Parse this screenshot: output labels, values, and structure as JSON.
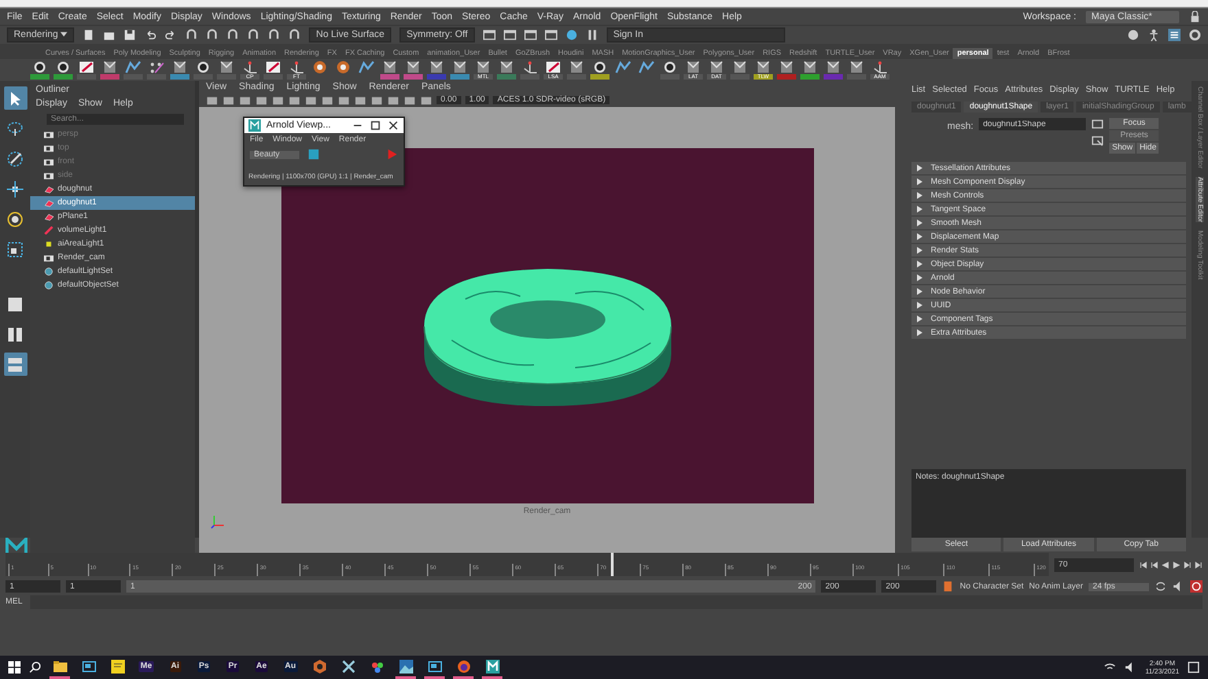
{
  "menu_bar": {
    "items": [
      "File",
      "Edit",
      "Create",
      "Select",
      "Modify",
      "Display",
      "Windows",
      "Lighting/Shading",
      "Texturing",
      "Render",
      "Toon",
      "Stereo",
      "Cache",
      "V-Ray",
      "Arnold",
      "OpenFlight",
      "Substance",
      "Help"
    ],
    "workspace_label": "Workspace :",
    "workspace": "Maya Classic*"
  },
  "status_line": {
    "menu_set": "Rendering",
    "live_surface": "No Live Surface",
    "symmetry": "Symmetry: Off",
    "sign_in": "Sign In"
  },
  "shelf": {
    "tabs": [
      {
        "label": "Curves / Surfaces",
        "selected": false
      },
      {
        "label": "Poly Modeling",
        "selected": false
      },
      {
        "label": "Sculpting",
        "selected": false
      },
      {
        "label": "Rigging",
        "selected": false
      },
      {
        "label": "Animation",
        "selected": false
      },
      {
        "label": "Rendering",
        "selected": false
      },
      {
        "label": "FX",
        "selected": false
      },
      {
        "label": "FX Caching",
        "selected": false
      },
      {
        "label": "Custom",
        "selected": false
      },
      {
        "label": "animation_User",
        "selected": false
      },
      {
        "label": "Bullet",
        "selected": false
      },
      {
        "label": "GoZBrush",
        "selected": false
      },
      {
        "label": "Houdini",
        "selected": false
      },
      {
        "label": "MASH",
        "selected": false
      },
      {
        "label": "MotionGraphics_User",
        "selected": false
      },
      {
        "label": "Polygons_User",
        "selected": false
      },
      {
        "label": "RIGS",
        "selected": false
      },
      {
        "label": "Redshift",
        "selected": false
      },
      {
        "label": "TURTLE_User",
        "selected": false
      },
      {
        "label": "VRay",
        "selected": false
      },
      {
        "label": "XGen_User",
        "selected": false
      },
      {
        "label": "personal",
        "selected": true
      },
      {
        "label": "test",
        "selected": false
      },
      {
        "label": "Arnold",
        "selected": false
      },
      {
        "label": "BFrost",
        "selected": false
      }
    ],
    "tools": [
      {
        "kind": "ball",
        "color": "#2e9a3a"
      },
      {
        "kind": "ball",
        "color": "#2e9a3a"
      },
      {
        "kind": "pen",
        "color": "#555555"
      },
      {
        "kind": "m",
        "color": "#c03a6a"
      },
      {
        "kind": "shape",
        "color": "#555555"
      },
      {
        "kind": "dots",
        "color": "#555555"
      },
      {
        "kind": "m",
        "color": "#3a8ab0"
      },
      {
        "kind": "ball",
        "color": "#555555"
      },
      {
        "kind": "m",
        "color": "#555555"
      },
      {
        "kind": "axes",
        "color": "#555555",
        "label": "CP"
      },
      {
        "kind": "pen",
        "color": "#555555"
      },
      {
        "kind": "axes",
        "color": "#555555",
        "label": "FT"
      },
      {
        "kind": "disc"
      },
      {
        "kind": "disc"
      },
      {
        "kind": "shape"
      },
      {
        "kind": "m",
        "color": "#c04a8a"
      },
      {
        "kind": "m",
        "color": "#c04a8a"
      },
      {
        "kind": "m",
        "color": "#3a3ab0"
      },
      {
        "kind": "m",
        "color": "#3a8ab0"
      },
      {
        "kind": "m",
        "color": "#555555",
        "label": "MTL"
      },
      {
        "kind": "m",
        "color": "#3a7a5a"
      },
      {
        "kind": "axes",
        "color": "#555555"
      },
      {
        "kind": "pen",
        "color": "#555555",
        "label": "LSA"
      },
      {
        "kind": "m",
        "color": "#555555"
      },
      {
        "kind": "ball",
        "color": "#a0a020"
      },
      {
        "kind": "shape"
      },
      {
        "kind": "shape"
      },
      {
        "kind": "ball",
        "color": "#555555"
      },
      {
        "kind": "m",
        "color": "#555555",
        "label": "LAT"
      },
      {
        "kind": "m",
        "color": "#555555",
        "label": "DAT"
      },
      {
        "kind": "m",
        "color": "#555555"
      },
      {
        "kind": "m",
        "color": "#a0a020",
        "label": "TLW"
      },
      {
        "kind": "m",
        "color": "#b02020"
      },
      {
        "kind": "m",
        "color": "#2ea02e"
      },
      {
        "kind": "m",
        "color": "#6a2ab0"
      },
      {
        "kind": "m",
        "color": "#555555"
      },
      {
        "kind": "axes",
        "color": "#555555",
        "label": "AAM"
      }
    ]
  },
  "outliner": {
    "title": "Outliner",
    "menus": [
      "Display",
      "Show",
      "Help"
    ],
    "search": {
      "placeholder": "Search..."
    },
    "items": [
      {
        "label": "persp",
        "kind": "camera",
        "selected": false,
        "dimmed": true
      },
      {
        "label": "top",
        "kind": "camera",
        "selected": false,
        "dimmed": true
      },
      {
        "label": "front",
        "kind": "camera",
        "selected": false,
        "dimmed": true
      },
      {
        "label": "side",
        "kind": "camera",
        "selected": false,
        "dimmed": true
      },
      {
        "label": "doughnut",
        "kind": "mesh",
        "selected": false,
        "dimmed": false
      },
      {
        "label": "doughnut1",
        "kind": "mesh",
        "selected": true,
        "dimmed": false
      },
      {
        "label": "pPlane1",
        "kind": "mesh",
        "selected": false,
        "dimmed": false
      },
      {
        "label": "volumeLight1",
        "kind": "light",
        "selected": false,
        "dimmed": false
      },
      {
        "label": "aiAreaLight1",
        "kind": "arealight",
        "selected": false,
        "dimmed": false
      },
      {
        "label": "Render_cam",
        "kind": "camera",
        "selected": false,
        "dimmed": false
      },
      {
        "label": "defaultLightSet",
        "kind": "set",
        "selected": false,
        "dimmed": false
      },
      {
        "label": "defaultObjectSet",
        "kind": "set",
        "selected": false,
        "dimmed": false
      }
    ]
  },
  "viewport": {
    "menus": [
      "View",
      "Shading",
      "Lighting",
      "Show",
      "Renderer",
      "Panels"
    ],
    "exposure": "0.00",
    "gamma": "1.00",
    "color_space": "ACES 1.0 SDR-video (sRGB)",
    "camera_label": "Render_cam"
  },
  "arnold_window": {
    "title": "Arnold Viewp...",
    "menus": [
      "File",
      "Window",
      "View",
      "Render"
    ],
    "aov": "Beauty",
    "status": "Rendering | 1100x700 (GPU) 1:1 | Render_cam"
  },
  "attribute_editor": {
    "menus": [
      "List",
      "Selected",
      "Focus",
      "Attributes",
      "Display",
      "Show",
      "TURTLE",
      "Help"
    ],
    "tabs": [
      {
        "label": "doughnut1",
        "selected": false
      },
      {
        "label": "doughnut1Shape",
        "selected": true
      },
      {
        "label": "layer1",
        "selected": false
      },
      {
        "label": "initialShadingGroup",
        "selected": false
      },
      {
        "label": "lamb",
        "selected": false
      }
    ],
    "mesh_label": "mesh:",
    "mesh": "doughnut1Shape",
    "focus": "Focus",
    "presets": "Presets",
    "show": "Show",
    "hide": "Hide",
    "sections": [
      "Tessellation Attributes",
      "Mesh Component Display",
      "Mesh Controls",
      "Tangent Space",
      "Smooth Mesh",
      "Displacement Map",
      "Render Stats",
      "Object Display",
      "Arnold",
      "Node Behavior",
      "UUID",
      "Component Tags",
      "Extra Attributes"
    ],
    "notes": "Notes:  doughnut1Shape",
    "buttons": [
      "Select",
      "Load Attributes",
      "Copy Tab"
    ]
  },
  "side_tabs": [
    {
      "label": "Channel Box / Layer Editor",
      "selected": false
    },
    {
      "label": "Attribute Editor",
      "selected": true
    },
    {
      "label": "Modeling Toolkit",
      "selected": false
    }
  ],
  "timeline": {
    "ticks": [
      "1",
      "5",
      "10",
      "15",
      "20",
      "25",
      "30",
      "35",
      "40",
      "45",
      "50",
      "55",
      "60",
      "65",
      "70",
      "75",
      "80",
      "85",
      "90",
      "95",
      "100",
      "105",
      "110",
      "115",
      "120"
    ],
    "current": "70",
    "level": 0.58
  },
  "range": {
    "level": 1,
    "start": "1",
    "playback_start": "1",
    "slider_start": "1",
    "slider_end": "200",
    "playback_end": "200",
    "end": "200",
    "character_set": "No Character Set",
    "anim_layer": "No Anim Layer",
    "fps": "24 fps"
  },
  "command_line": {
    "language": "MEL"
  },
  "taskbar": {
    "apps": [
      {
        "kind": "folder",
        "active": true
      },
      {
        "kind": "window",
        "active": false
      },
      {
        "kind": "note",
        "active": false
      },
      {
        "kind": "text",
        "label": "Me",
        "color": "#2a1a5a",
        "active": false
      },
      {
        "kind": "text",
        "label": "Ai",
        "color": "#3a1a0a",
        "active": false
      },
      {
        "kind": "text",
        "label": "Ps",
        "color": "#0a1a3a",
        "active": false
      },
      {
        "kind": "text",
        "label": "Pr",
        "color": "#1a0a3a",
        "active": false
      },
      {
        "kind": "text",
        "label": "Ae",
        "color": "#1a0a3a",
        "active": false
      },
      {
        "kind": "text",
        "label": "Au",
        "color": "#0a1a3a",
        "active": false
      },
      {
        "kind": "hex",
        "active": false
      },
      {
        "kind": "cross",
        "active": false
      },
      {
        "kind": "wheel",
        "active": false
      },
      {
        "kind": "photo",
        "active": true
      },
      {
        "kind": "window",
        "active": true
      },
      {
        "kind": "fox",
        "active": true
      },
      {
        "kind": "maya",
        "active": true
      }
    ],
    "time": "2:40 PM",
    "date": "11/23/2021"
  }
}
